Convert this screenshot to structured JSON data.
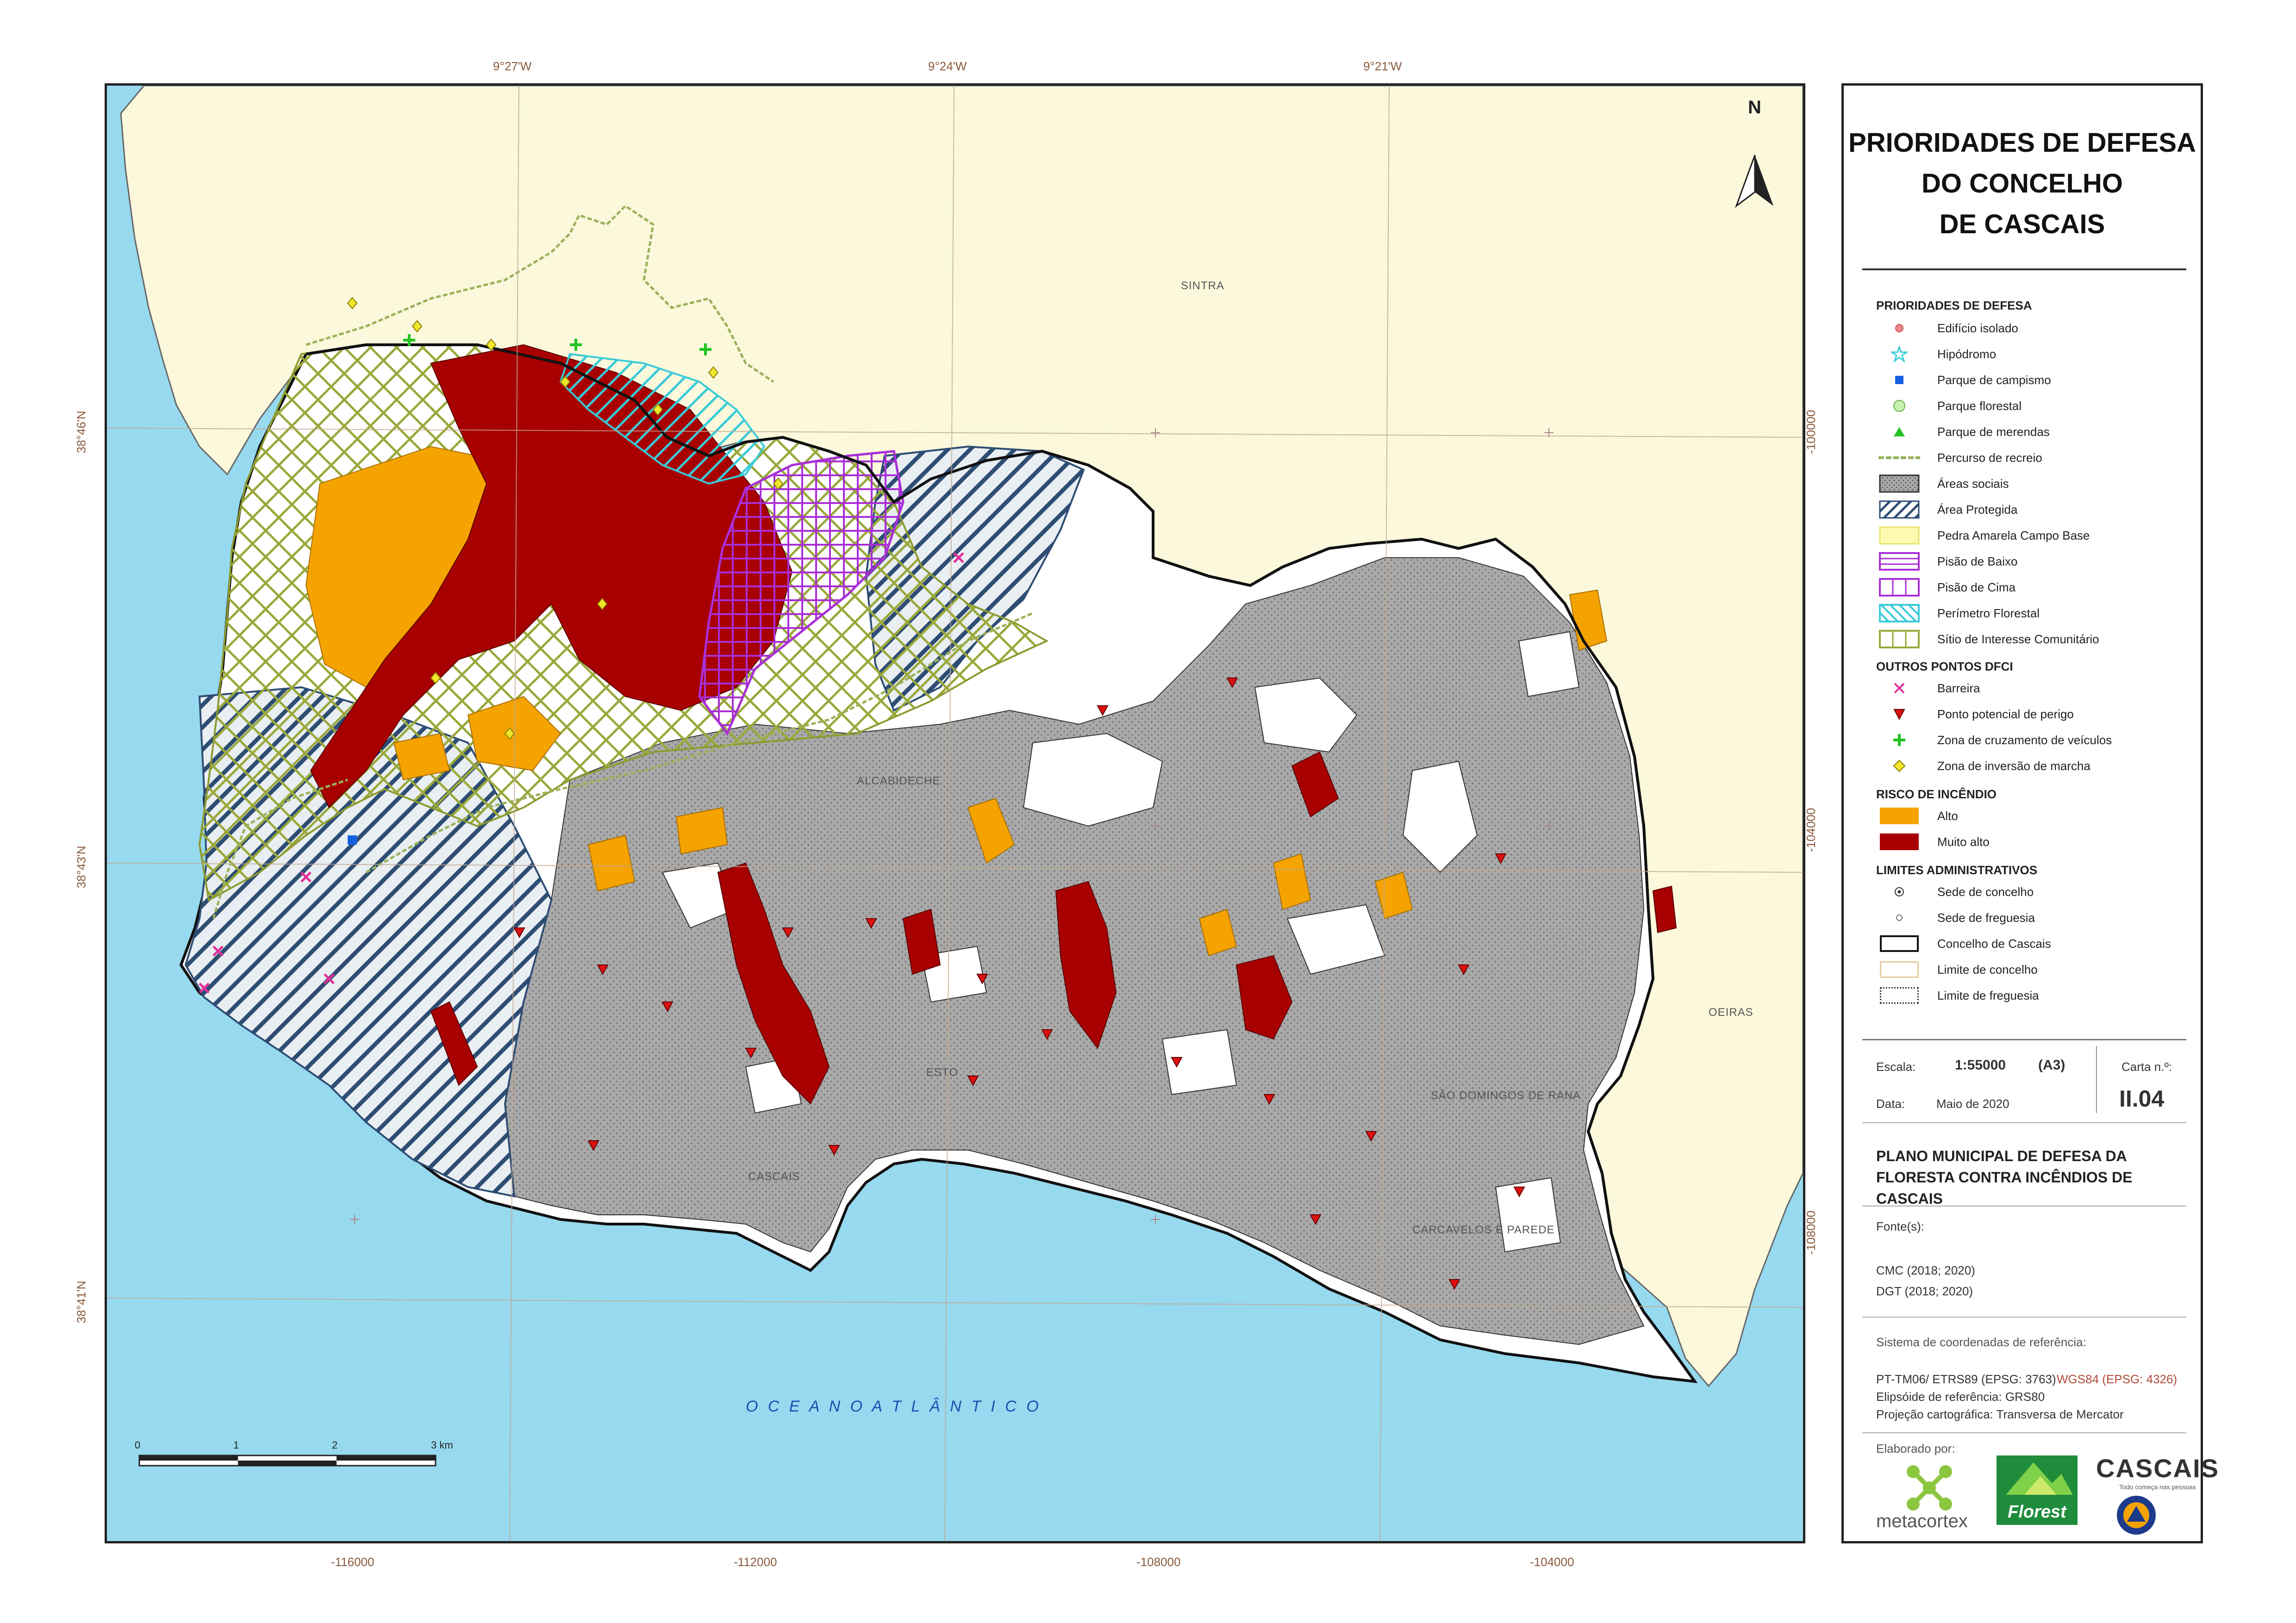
{
  "map": {
    "top_coords": [
      "9°27'W",
      "9°24'W",
      "9°21'W"
    ],
    "bottom_coords": [
      "-116000",
      "-112000",
      "-108000",
      "-104000"
    ],
    "left_coords": [
      "38°46'N",
      "38°43'N",
      "38°41'N"
    ],
    "right_coords": [
      "-100000",
      "-104000",
      "-108000"
    ],
    "places": {
      "sintra": "SINTRA",
      "oeiras": "OEIRAS",
      "alcabideche": "ALCABIDECHE",
      "estoril": "ESTO",
      "cascais": "CASCAIS",
      "sdr": "SÃO DOMINGOS DE RANA",
      "carcavelos": "CARCAVELOS E PAREDE",
      "ocean": "O C E A N O    A T L Â N T I C O"
    },
    "north_label": "N",
    "scalebar": {
      "labels": [
        "0",
        "1",
        "2",
        "3 km"
      ]
    }
  },
  "legend": {
    "title_lines": [
      "PRIORIDADES DE DEFESA",
      "DO CONCELHO",
      "DE CASCAIS"
    ],
    "sections": [
      {
        "heading": "PRIORIDADES DE DEFESA",
        "items": [
          {
            "label": "Edifício isolado",
            "icon": "pink-dot-icon"
          },
          {
            "label": "Hipódromo",
            "icon": "cyan-star-icon"
          },
          {
            "label": "Parque de campismo",
            "icon": "blue-square-icon"
          },
          {
            "label": "Parque florestal",
            "icon": "green-circle-icon"
          },
          {
            "label": "Parque de merendas",
            "icon": "green-triangle-icon"
          },
          {
            "label": "Percurso de recreio",
            "icon": "recreation-path-icon"
          },
          {
            "label": "Áreas sociais",
            "icon": "social-area-icon"
          },
          {
            "label": "Área Protegida",
            "icon": "protected-area-icon"
          },
          {
            "label": "Pedra Amarela Campo Base",
            "icon": "pedra-amarela-icon"
          },
          {
            "label": "Pisão de Baixo",
            "icon": "pisao-baixo-icon"
          },
          {
            "label": "Pisão de Cima",
            "icon": "pisao-cima-icon"
          },
          {
            "label": "Perímetro Florestal",
            "icon": "forest-perimeter-icon"
          },
          {
            "label": "Sítio de Interesse Comunitário",
            "icon": "community-site-icon"
          }
        ]
      },
      {
        "heading": "OUTROS PONTOS DFCI",
        "items": [
          {
            "label": "Barreira",
            "icon": "magenta-x-icon"
          },
          {
            "label": "Ponto potencial de perigo",
            "icon": "red-triangle-icon"
          },
          {
            "label": "Zona de cruzamento de veículos",
            "icon": "green-cross-icon"
          },
          {
            "label": "Zona de inversão de marcha",
            "icon": "yellow-diamond-icon"
          }
        ]
      },
      {
        "heading": "RISCO DE INCÊNDIO",
        "items": [
          {
            "label": "Alto",
            "icon": "orange-fill-icon"
          },
          {
            "label": "Muito alto",
            "icon": "darkred-fill-icon"
          }
        ]
      },
      {
        "heading": "LIMITES ADMINISTRATIVOS",
        "items": [
          {
            "label": "Sede de concelho",
            "icon": "council-seat-icon"
          },
          {
            "label": "Sede de freguesia",
            "icon": "parish-seat-icon"
          },
          {
            "label": "Concelho de Cascais",
            "icon": "cascais-boundary-icon"
          },
          {
            "label": "Limite de concelho",
            "icon": "council-limit-icon"
          },
          {
            "label": "Limite de freguesia",
            "icon": "parish-limit-icon"
          }
        ]
      }
    ],
    "meta": {
      "scale_label": "Escala:",
      "scale_value": "1:55000",
      "paper": "(A3)",
      "sheet_label": "Carta n.º:",
      "sheet_value": "II.04",
      "date_label": "Data:",
      "date_value": "Maio de 2020"
    },
    "plan_title": [
      "PLANO MUNICIPAL DE DEFESA DA",
      "FLORESTA CONTRA INCÊNDIOS DE CASCAIS"
    ],
    "sources_label": "Fonte(s):",
    "sources": [
      "CMC (2018; 2020)",
      "DGT (2018; 2020)"
    ],
    "crs_label": "Sistema de coordenadas de referência:",
    "crs_line1a": "PT-TM06/ ETRS89 (EPSG: 3763)",
    "crs_line1b": "WGS84 (EPSG: 4326)",
    "crs_line2": "Elipsóide de referência: GRS80",
    "crs_line3": "Projeção cartográfica: Transversa de Mercator",
    "made_by": "Elaborado por:",
    "logos": {
      "metacortex": "metacortex",
      "florest": "Florest",
      "cascais": "CASCAIS",
      "cascais_tag": "Todo começa nas pessoas"
    }
  },
  "colors": {
    "sea": "#97d9ef",
    "land": "#fbf8dc",
    "alto": "#f5a300",
    "muito_alto": "#a80000",
    "social": "#a7a7a7",
    "protected": "#2e4d73",
    "sic": "#9aa83a",
    "pisao": "#a92fd6",
    "perimetro": "#38cbd8",
    "boundary": "#111111",
    "coord_text": "#8a5a3c",
    "wgs_text": "#b04a3a"
  }
}
